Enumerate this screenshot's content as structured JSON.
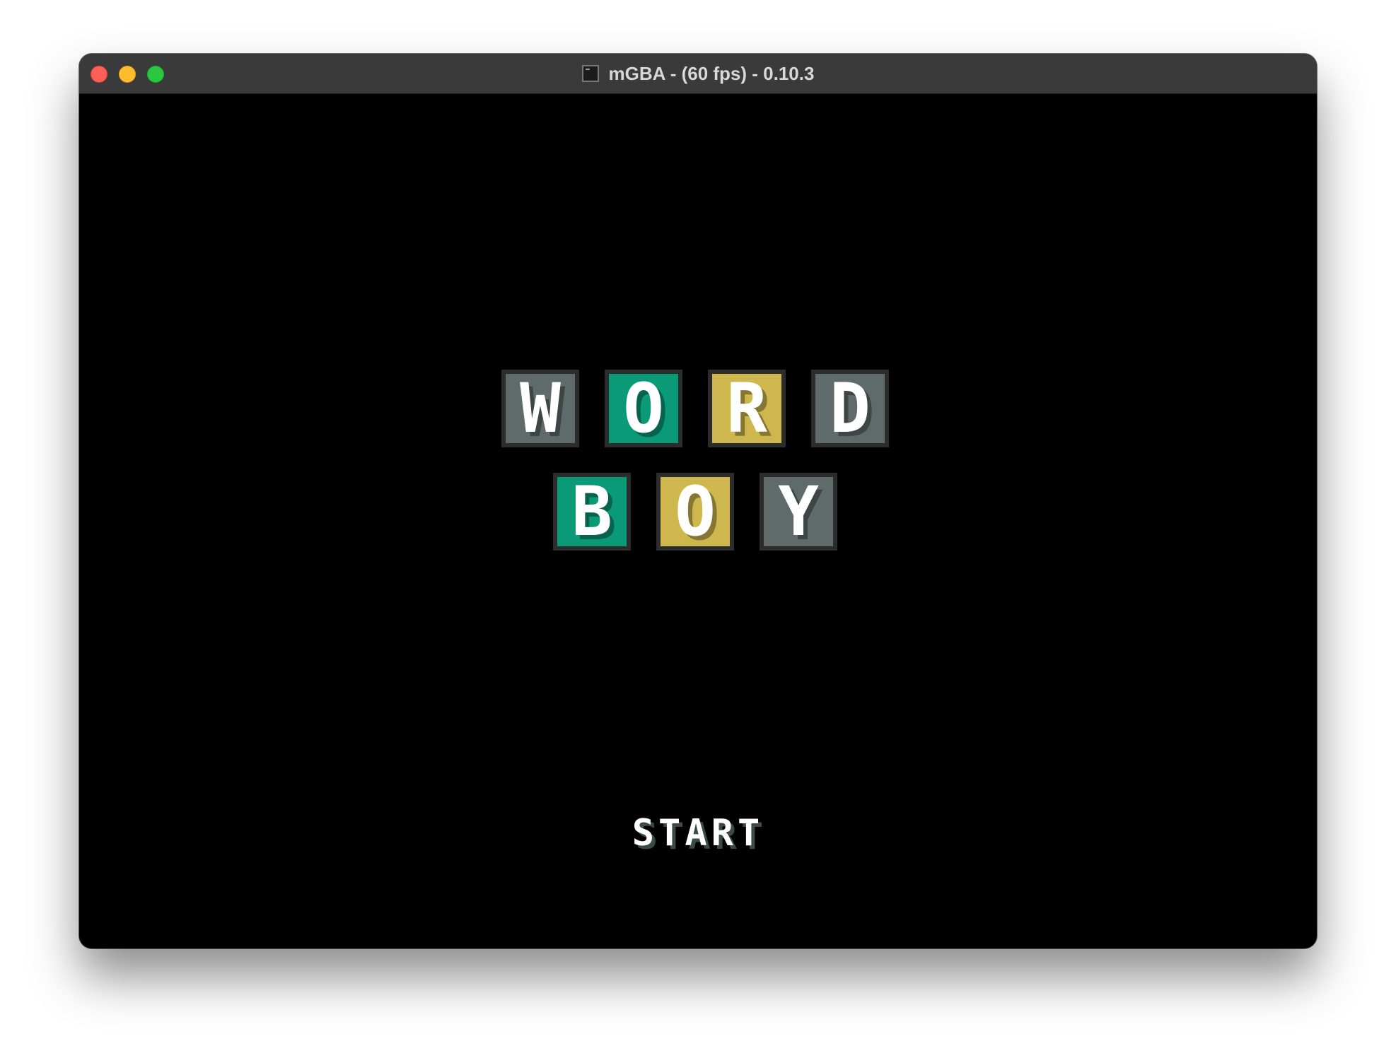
{
  "window": {
    "title": "mGBA -  (60 fps) - 0.10.3"
  },
  "colors": {
    "gray": "#5f6b6b",
    "green": "#0a9a78",
    "yellow": "#cdb74e"
  },
  "logo": {
    "row1": [
      {
        "letter": "W",
        "color": "gray"
      },
      {
        "letter": "O",
        "color": "green"
      },
      {
        "letter": "R",
        "color": "yellow"
      },
      {
        "letter": "D",
        "color": "gray"
      }
    ],
    "row2": [
      {
        "letter": "B",
        "color": "green"
      },
      {
        "letter": "O",
        "color": "yellow"
      },
      {
        "letter": "Y",
        "color": "gray"
      }
    ]
  },
  "menu": {
    "start_label": "START"
  }
}
